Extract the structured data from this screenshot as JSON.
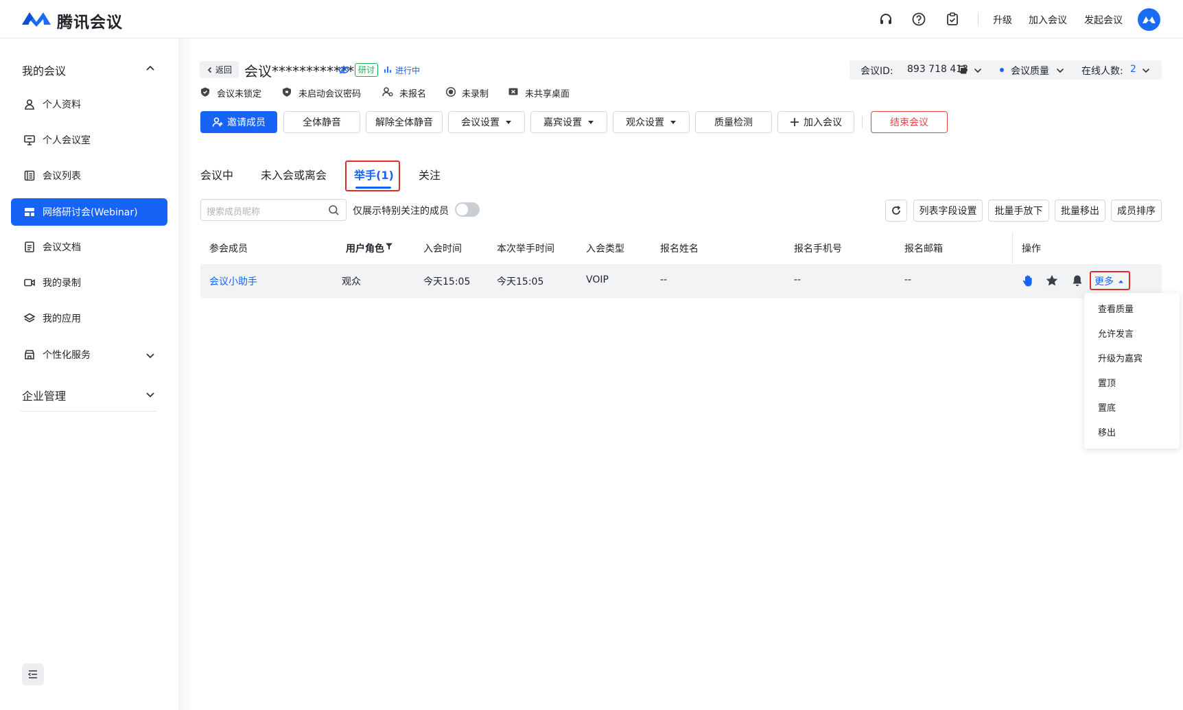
{
  "app": {
    "name": "腾讯会议"
  },
  "topbar": {
    "upgrade": "升级",
    "join": "加入会议",
    "start": "发起会议"
  },
  "sidebar": {
    "my_meetings": "我的会议",
    "items": [
      {
        "label": "个人资料",
        "icon": "user-icon"
      },
      {
        "label": "个人会议室",
        "icon": "presentation-icon"
      },
      {
        "label": "会议列表",
        "icon": "list-icon"
      },
      {
        "label": "网络研讨会(Webinar)",
        "icon": "webinar-icon"
      },
      {
        "label": "会议文档",
        "icon": "document-icon"
      },
      {
        "label": "我的录制",
        "icon": "video-icon"
      },
      {
        "label": "我的应用",
        "icon": "layers-icon"
      },
      {
        "label": "个性化服务",
        "icon": "store-icon"
      }
    ],
    "enterprise": "企业管理"
  },
  "meeting": {
    "back": "返回",
    "title": "会议************",
    "tag": "研讨",
    "status": "进行中",
    "id_label": "会议ID:",
    "id": "893 718 413",
    "quality": "会议质量",
    "online_label": "在线人数:",
    "online_count": "2"
  },
  "status_row": [
    "会议未锁定",
    "未启动会议密码",
    "未报名",
    "未录制",
    "未共享桌面"
  ],
  "actions": {
    "invite": "邀请成员",
    "mute_all": "全体静音",
    "unmute_all": "解除全体静音",
    "meeting_settings": "会议设置",
    "guest_settings": "嘉宾设置",
    "audience_settings": "观众设置",
    "quality_check": "质量检测",
    "join": "加入会议",
    "end": "结束会议"
  },
  "tabs": [
    "会议中",
    "未入会或离会",
    "举手(1)",
    "关注"
  ],
  "filter": {
    "search_placeholder": "搜索成员昵称",
    "toggle_label": "仅展示特别关注的成员",
    "column_settings": "列表字段设置",
    "lower_hands": "批量手放下",
    "remove_batch": "批量移出",
    "sort": "成员排序"
  },
  "table": {
    "headers": [
      "参会成员",
      "用户角色",
      "入会时间",
      "本次举手时间",
      "入会类型",
      "报名姓名",
      "报名手机号",
      "报名邮箱",
      "操作"
    ],
    "rows": [
      {
        "member": "会议小助手",
        "role": "观众",
        "join_time": "今天15:05",
        "hand_time": "今天15:05",
        "type": "VOIP",
        "reg_name": "--",
        "reg_phone": "--",
        "reg_email": "--",
        "more": "更多"
      }
    ]
  },
  "more_menu": [
    "查看质量",
    "允许发言",
    "升级为嘉宾",
    "置顶",
    "置底",
    "移出"
  ],
  "colors": {
    "primary": "#1763f5",
    "danger": "#e54545",
    "highlight": "#e52a2a"
  }
}
